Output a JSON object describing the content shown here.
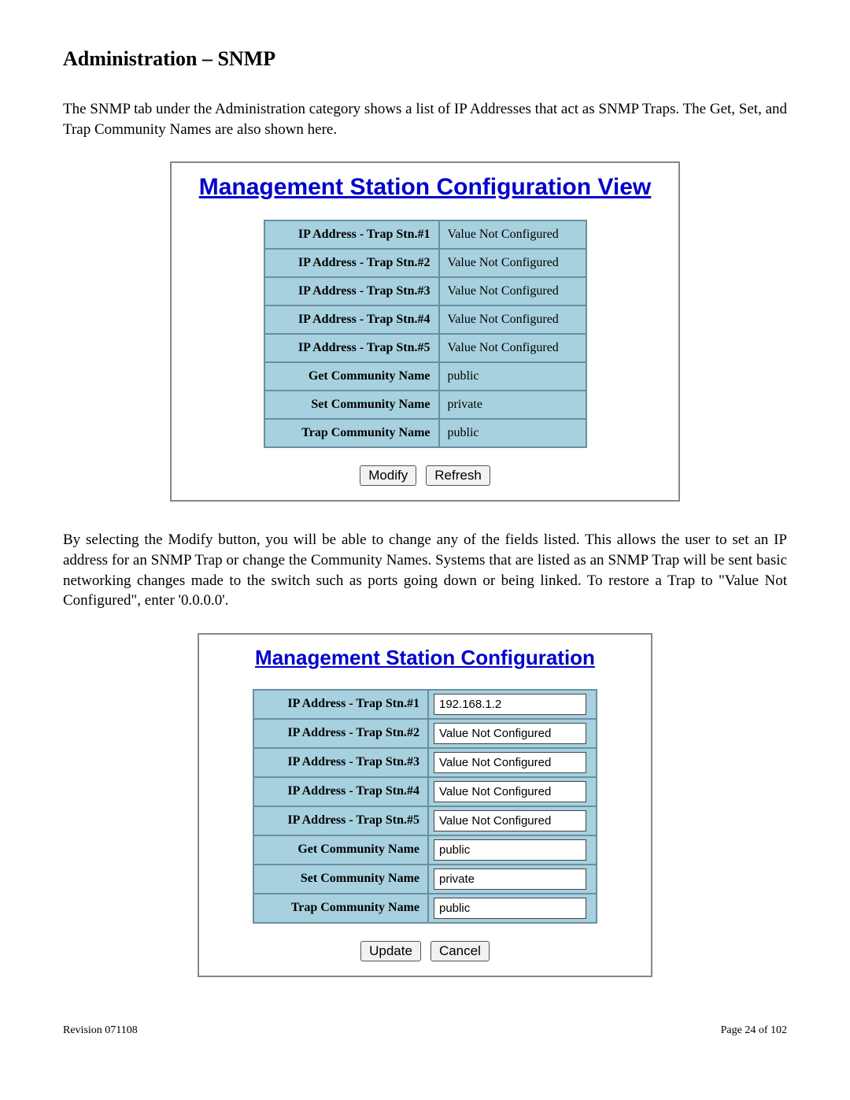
{
  "heading": "Administration – SNMP",
  "intro_text": "The SNMP tab under the Administration category shows a list of IP Addresses that act as SNMP Traps. The Get, Set, and Trap Community Names are also shown here.",
  "view_panel": {
    "title": "Management Station Configuration View",
    "rows": [
      {
        "label": "IP Address - Trap Stn.#1",
        "value": "Value Not Configured"
      },
      {
        "label": "IP Address - Trap Stn.#2",
        "value": "Value Not Configured"
      },
      {
        "label": "IP Address - Trap Stn.#3",
        "value": "Value Not Configured"
      },
      {
        "label": "IP Address - Trap Stn.#4",
        "value": "Value Not Configured"
      },
      {
        "label": "IP Address - Trap Stn.#5",
        "value": "Value Not Configured"
      },
      {
        "label": "Get Community Name",
        "value": "public"
      },
      {
        "label": "Set Community Name",
        "value": "private"
      },
      {
        "label": "Trap Community Name",
        "value": "public"
      }
    ],
    "buttons": {
      "modify": "Modify",
      "refresh": "Refresh"
    }
  },
  "mid_text": "By selecting the Modify button, you will be able to change any of the fields listed.  This allows the user to set an IP address for an SNMP Trap or change the Community Names.  Systems that are listed as an SNMP Trap will be sent basic networking changes made to the switch such as ports going down or being linked.  To restore a Trap to \"Value Not Configured\", enter '0.0.0.0'.",
  "config_panel": {
    "title": "Management Station Configuration",
    "rows": [
      {
        "label": "IP Address - Trap Stn.#1",
        "value": "192.168.1.2"
      },
      {
        "label": "IP Address - Trap Stn.#2",
        "value": "Value Not Configured"
      },
      {
        "label": "IP Address - Trap Stn.#3",
        "value": "Value Not Configured"
      },
      {
        "label": "IP Address - Trap Stn.#4",
        "value": "Value Not Configured"
      },
      {
        "label": "IP Address - Trap Stn.#5",
        "value": "Value Not Configured"
      },
      {
        "label": "Get Community Name",
        "value": "public"
      },
      {
        "label": "Set Community Name",
        "value": "private"
      },
      {
        "label": "Trap Community Name",
        "value": "public"
      }
    ],
    "buttons": {
      "update": "Update",
      "cancel": "Cancel"
    }
  },
  "footer": {
    "revision": "Revision 071108",
    "page": "Page 24 of 102"
  }
}
